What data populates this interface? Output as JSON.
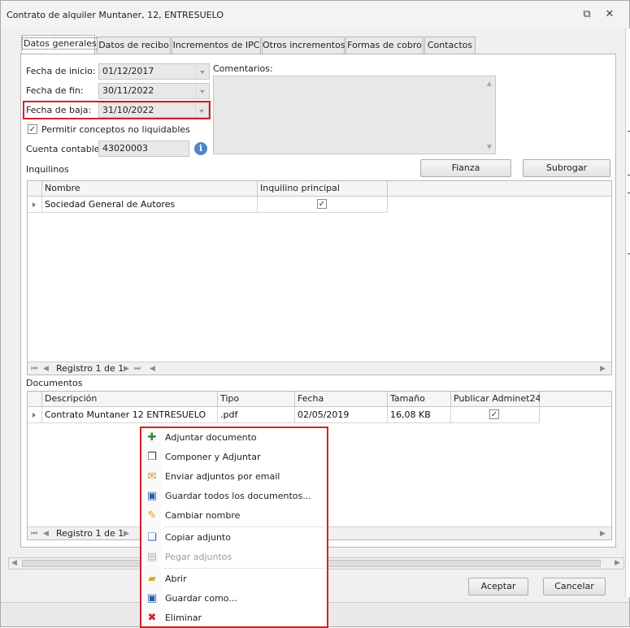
{
  "window": {
    "title": "Contrato de alquiler Muntaner, 12, ENTRESUELO",
    "restore_glyph": "⧉",
    "close_glyph": "✕"
  },
  "tabs": [
    {
      "label": "Datos generales",
      "active": true
    },
    {
      "label": "Datos de recibo",
      "active": false
    },
    {
      "label": "Incrementos de IPC",
      "active": false
    },
    {
      "label": "Otros incrementos",
      "active": false
    },
    {
      "label": "Formas de cobro",
      "active": false
    },
    {
      "label": "Contactos",
      "active": false
    }
  ],
  "form": {
    "fecha_inicio_label": "Fecha de inicio:",
    "fecha_inicio_value": "01/12/2017",
    "fecha_fin_label": "Fecha de fin:",
    "fecha_fin_value": "30/11/2022",
    "fecha_baja_label": "Fecha de baja:",
    "fecha_baja_value": "31/10/2022",
    "comentarios_label": "Comentarios:",
    "permitir_label": "Permitir conceptos no liquidables",
    "permitir_checked": true,
    "cuenta_label": "Cuenta contable:",
    "cuenta_value": "43020003"
  },
  "inquilinos": {
    "section_label": "Inquilinos",
    "fianza_button": "Fianza",
    "subrogar_button": "Subrogar",
    "columns": [
      "Nombre",
      "Inquilino principal"
    ],
    "rows": [
      {
        "nombre": "Sociedad General de Autores",
        "principal": true
      }
    ],
    "navigator": "Registro 1 de 1"
  },
  "documentos": {
    "section_label": "Documentos",
    "columns": [
      "Descripción",
      "Tipo",
      "Fecha",
      "Tamaño",
      "Publicar Adminet24H"
    ],
    "rows": [
      {
        "descripcion": "Contrato Muntaner 12 ENTRESUELO",
        "tipo": ".pdf",
        "fecha": "02/05/2019",
        "tamano": "16,08 KB",
        "publicar": true
      }
    ],
    "navigator": "Registro 1 de 1"
  },
  "context_menu": {
    "items": [
      {
        "label": "Adjuntar documento",
        "icon": "attach-document-icon",
        "glyph": "✚",
        "color": "#2e8b2e",
        "enabled": true
      },
      {
        "label": "Componer y Adjuntar",
        "icon": "compose-attach-icon",
        "glyph": "❐",
        "color": "#444444",
        "enabled": true
      },
      {
        "label": "Enviar adjuntos por email",
        "icon": "email-attachments-icon",
        "glyph": "✉",
        "color": "#c79a1e",
        "enabled": true
      },
      {
        "label": "Guardar todos los documentos...",
        "icon": "save-all-icon",
        "glyph": "▣",
        "color": "#2a5fa8",
        "enabled": true
      },
      {
        "label": "Cambiar nombre",
        "icon": "rename-pencil-icon",
        "glyph": "✎",
        "color": "#d8a010",
        "enabled": true
      },
      {
        "label": "Copiar adjunto",
        "icon": "copy-icon",
        "glyph": "❏",
        "color": "#3a6fb8",
        "enabled": true
      },
      {
        "label": "Pegar adjuntos",
        "icon": "paste-icon",
        "glyph": "▤",
        "color": "#b0b0b0",
        "enabled": false
      },
      {
        "label": "Abrir",
        "icon": "open-folder-icon",
        "glyph": "▰",
        "color": "#e0a82a",
        "enabled": true
      },
      {
        "label": "Guardar como...",
        "icon": "save-as-icon",
        "glyph": "▣",
        "color": "#2a5fa8",
        "enabled": true
      },
      {
        "label": "Eliminar",
        "icon": "delete-icon",
        "glyph": "✖",
        "color": "#d02020",
        "enabled": true
      }
    ]
  },
  "footer": {
    "aceptar_button": "Aceptar",
    "cancelar_button": "Cancelar"
  }
}
